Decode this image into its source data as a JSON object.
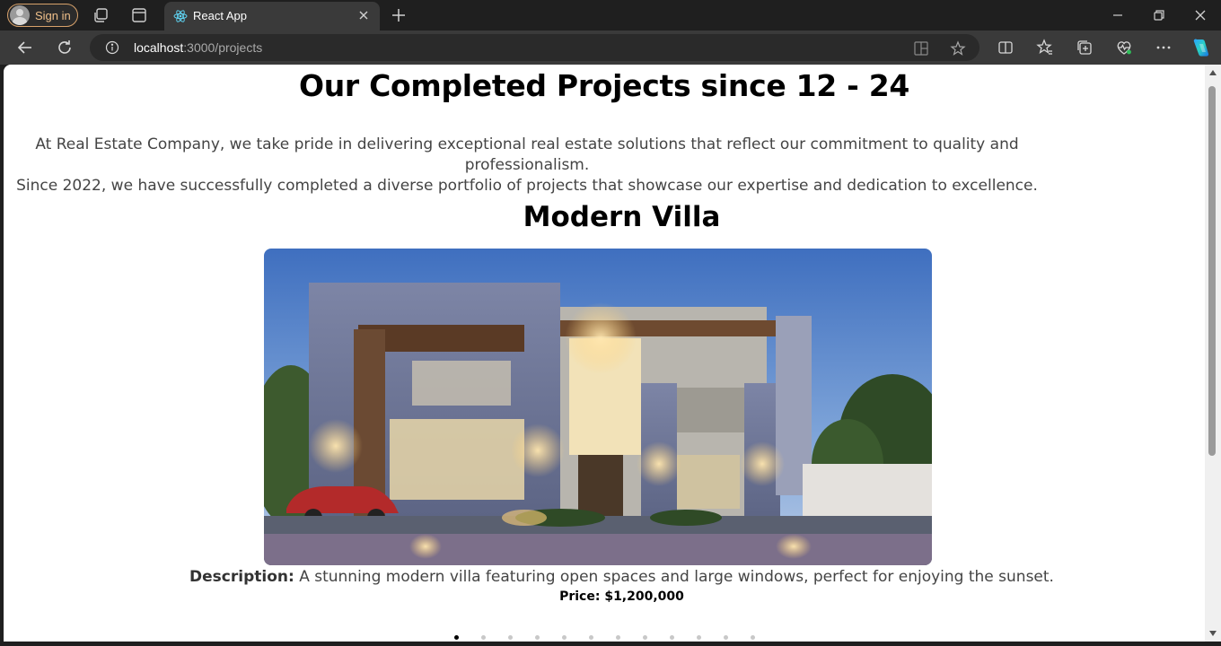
{
  "browser": {
    "signin_label": "Sign in",
    "tab_title": "React App",
    "url_host": "localhost",
    "url_path": ":3000/projects"
  },
  "page": {
    "title": "Our Completed Projects since 12 - 24",
    "intro_line1": "At Real Estate Company, we take pride in delivering exceptional real estate solutions that reflect our commitment to quality and professionalism.",
    "intro_line2": "Since 2022, we have successfully completed a diverse portfolio of projects that showcase our expertise and dedication to excellence."
  },
  "project": {
    "title": "Modern Villa",
    "description_label": "Description:",
    "description": "A stunning modern villa featuring open spaces and large windows, perfect for enjoying the sunset.",
    "price": "Price: $1,200,000"
  },
  "carousel": {
    "slide_count": 12,
    "active_index": 0
  },
  "colors": {
    "accent_signin": "#d7a16a",
    "react_blue": "#61dafb"
  }
}
